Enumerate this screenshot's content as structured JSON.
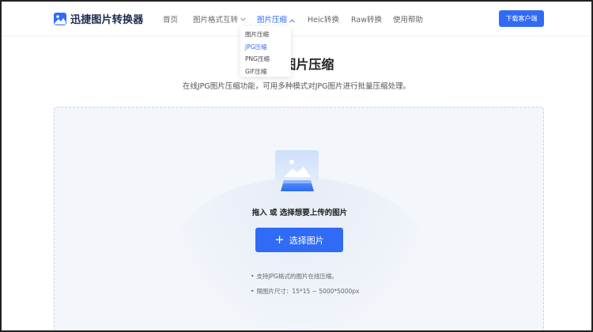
{
  "header": {
    "logo_text": "迅捷图片转换器",
    "nav": {
      "home": "首页",
      "format": "图片格式互转",
      "compress": "图片压缩",
      "heic": "Heic转换",
      "raw": "Raw转换",
      "help": "使用帮助"
    },
    "download_label": "下载客户端"
  },
  "dropdown": {
    "items": [
      "图片压缩",
      "JPG压缩",
      "PNG压缩",
      "GIF压缩"
    ],
    "selected": "JPG压缩"
  },
  "main": {
    "title": "JPG图片压缩",
    "subtitle": "在线JPG图片压缩功能，可用多种模式对JPG图片进行批量压缩处理。",
    "drop_text": "拖入 或 选择想要上传的图片",
    "select_button": "选择图片",
    "tips": [
      "支持JPG格式的图片在线压缩。",
      "限图片尺寸：15*15 ~ 5000*5000px"
    ]
  },
  "colors": {
    "accent": "#2f6bf4",
    "box_bg": "#f3f6fb"
  }
}
